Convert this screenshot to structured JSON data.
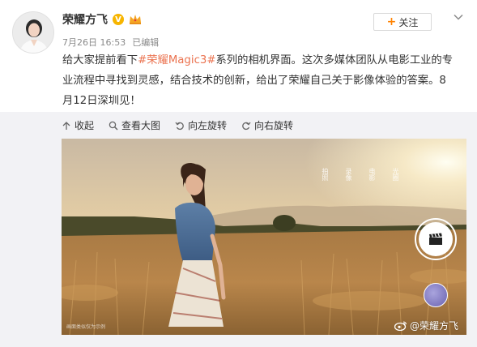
{
  "author": {
    "name": "荣耀方飞",
    "verified_badge": "V",
    "verified_icon": "verified-v-icon",
    "member_icon": "crown-icon"
  },
  "meta": {
    "date": "7月26日 16:53",
    "edited": "已编辑"
  },
  "follow": {
    "label": "关注",
    "icon": "plus-icon"
  },
  "post": {
    "lines": [
      {
        "before": "给大家提前看下",
        "topic": "#荣耀Magic3#",
        "after": "系列的相机界面。这次多媒体团队从电影工业的专"
      },
      {
        "text": "业流程中寻找到灵感，结合技术的创新，给出了荣耀自己关于影像体验的答案。8"
      },
      {
        "text": "月12日深圳见！"
      }
    ]
  },
  "toolbar": {
    "collapse": "收起",
    "view_large": "查看大图",
    "rotate_left": "向左旋转",
    "rotate_right": "向右旋转"
  },
  "photo": {
    "small_watermark": "画面类似仅为示例",
    "camera_modes": [
      "光圈",
      "电影",
      "录像",
      "拍照"
    ],
    "shutter_icon": "movie-clapper-icon"
  },
  "watermark": {
    "text": "@荣耀方飞",
    "icon": "weibo-logo-icon"
  },
  "colors": {
    "topic": "#eb7350",
    "follow_plus": "#ff8200",
    "badge": "#f7b500",
    "panel_bg": "#f2f2f5"
  }
}
